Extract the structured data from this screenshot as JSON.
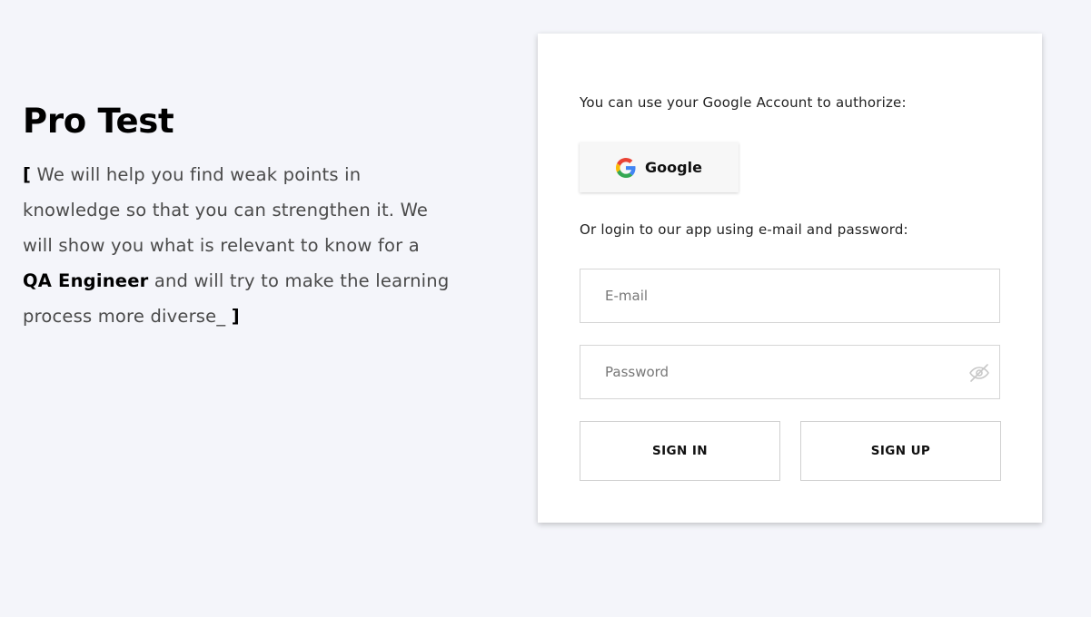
{
  "hero": {
    "title": "Pro Test",
    "open_bracket": "[",
    "text_before": " We will help you find weak points in knowledge so that you can strengthen it. We will show you what is relevant to know for a ",
    "highlight": "QA Engineer",
    "text_after": " and will try to make the learning process more diverse_ ",
    "close_bracket": "]"
  },
  "auth": {
    "google_prompt": "You can use your Google Account to authorize:",
    "google_button_label": "Google",
    "login_prompt": "Or login to our app using e-mail and password:",
    "email": {
      "placeholder": "E-mail",
      "value": ""
    },
    "password": {
      "placeholder": "Password",
      "value": ""
    },
    "sign_in_label": "SIGN IN",
    "sign_up_label": "SIGN UP",
    "icons": {
      "google": "google-g-icon",
      "password_toggle": "eye-slash-icon"
    }
  },
  "colors": {
    "background": "#f4f5fa",
    "card": "#ffffff",
    "google_blue": "#4285F4",
    "google_red": "#EA4335",
    "google_yellow": "#FBBC05",
    "google_green": "#34A853"
  }
}
